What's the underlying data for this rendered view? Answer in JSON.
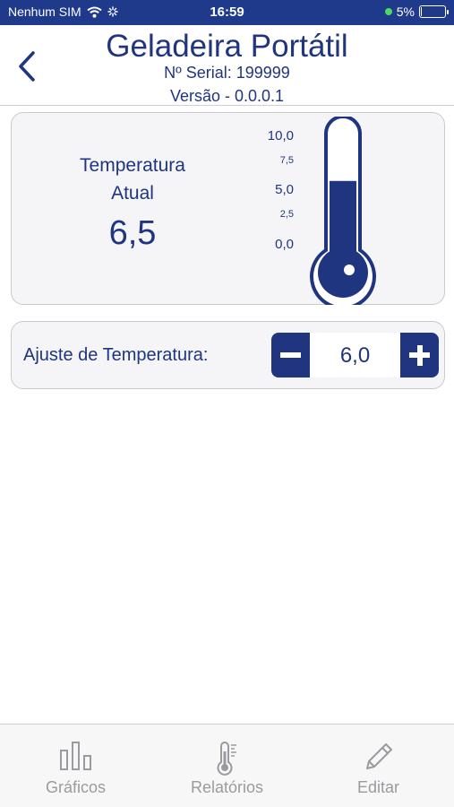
{
  "status_bar": {
    "carrier": "Nenhum SIM",
    "time": "16:59",
    "battery_percent": "5%",
    "battery_level": 0.05,
    "bar_color": "#1f3a8a"
  },
  "header": {
    "title": "Geladeira Portátil",
    "serial": "Nº Serial: 199999",
    "version": "Versão - 0.0.0.1"
  },
  "temperature": {
    "label_line1": "Temperatura",
    "label_line2": "Atual",
    "current": "6,5",
    "scale": {
      "t100": "10,0",
      "t75": "7,5",
      "t50": "5,0",
      "t25": "2,5",
      "t00": "0,0"
    },
    "fill_level": 0.65
  },
  "adjust": {
    "label": "Ajuste de Temperatura:",
    "value": "6,0"
  },
  "tabs": [
    {
      "label": "Gráficos",
      "icon": "bar-chart-icon"
    },
    {
      "label": "Relatórios",
      "icon": "thermometer-icon"
    },
    {
      "label": "Editar",
      "icon": "pencil-icon"
    }
  ],
  "colors": {
    "primary": "#1f3580",
    "inactive_tab": "#9a9aa0",
    "card_bg": "#f5f5f7"
  }
}
